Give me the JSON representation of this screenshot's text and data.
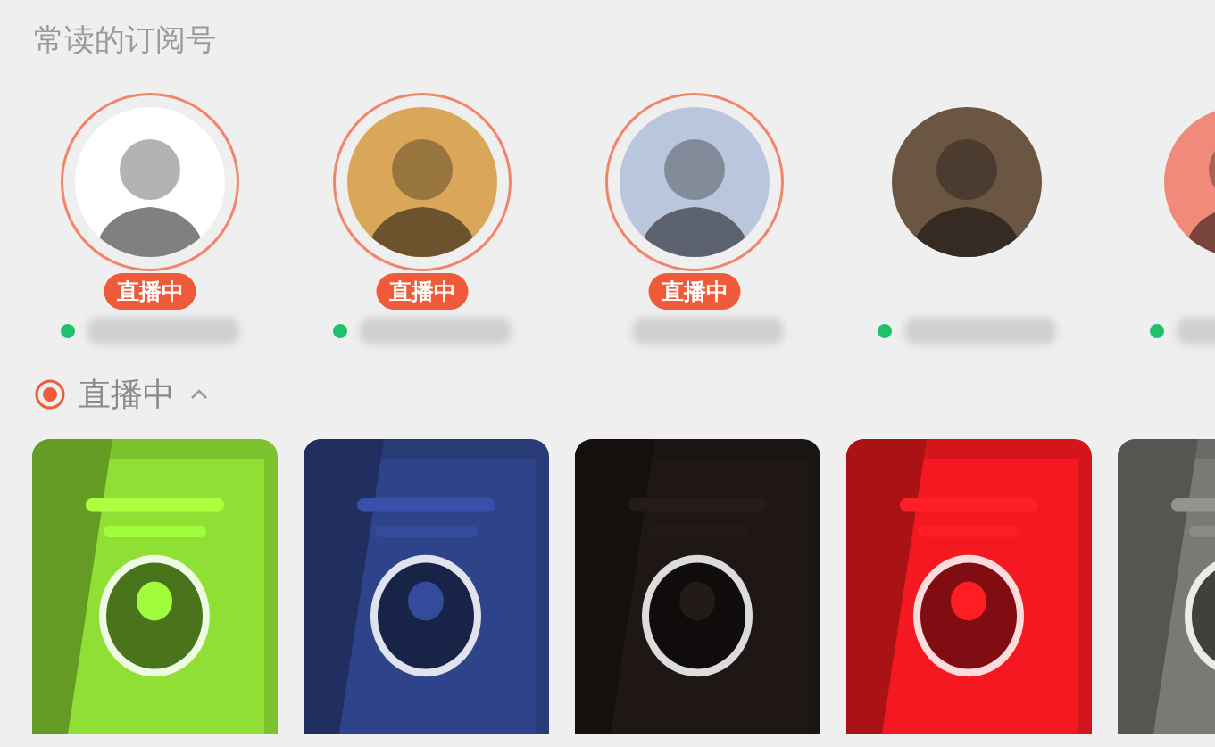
{
  "subscriptions_title": "常读的订阅号",
  "subscriptions": [
    {
      "live": true,
      "live_badge": "直播中",
      "online": true,
      "color": "#ffffff"
    },
    {
      "live": true,
      "live_badge": "直播中",
      "online": true,
      "color": "#d9a65a"
    },
    {
      "live": true,
      "live_badge": "直播中",
      "online": false,
      "color": "#b9c6dc"
    },
    {
      "live": false,
      "online": true,
      "color": "#6b5643"
    },
    {
      "live": false,
      "online": true,
      "color": "#f08a7a"
    }
  ],
  "live_section": {
    "title": "直播中",
    "expanded": true
  }
}
